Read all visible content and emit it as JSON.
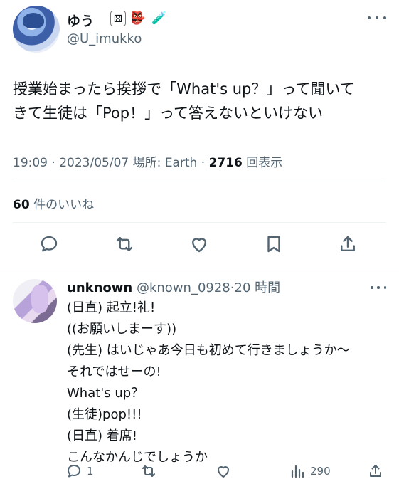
{
  "tweet": {
    "display_name": "ゆう",
    "emoji_dice": "⚄",
    "emoji_tengu": "👺",
    "emoji_tube": "🧪",
    "handle": "@U_imukko",
    "text_lines": [
      "授業始まったら挨拶で「What's up？」って聞いて",
      "きて生徒は「Pop！」って答えないといけない"
    ],
    "time": "19:09",
    "date": "2023/05/07",
    "location": "場所: Earth",
    "views_count": "2716",
    "views_label": "回表示",
    "likes_count": "60",
    "likes_label": "件のいいね"
  },
  "reply": {
    "name": "unknown",
    "handle": "@known_0928",
    "time": "20 時間",
    "lines": [
      "(日直) 起立!礼!",
      "((お願いしまーす))",
      "(先生) はいじゃあ今日も初めて行きましょうか〜",
      "それではせーの!",
      "What's up？",
      "(生徒)pop!!!",
      "(日直) 着席!",
      "こんなかんじでしょうか"
    ],
    "reply_count": "1",
    "views_count": "290"
  },
  "colors": {
    "text": "#0f1419",
    "secondary": "#536471",
    "divider": "#eff3f4"
  }
}
